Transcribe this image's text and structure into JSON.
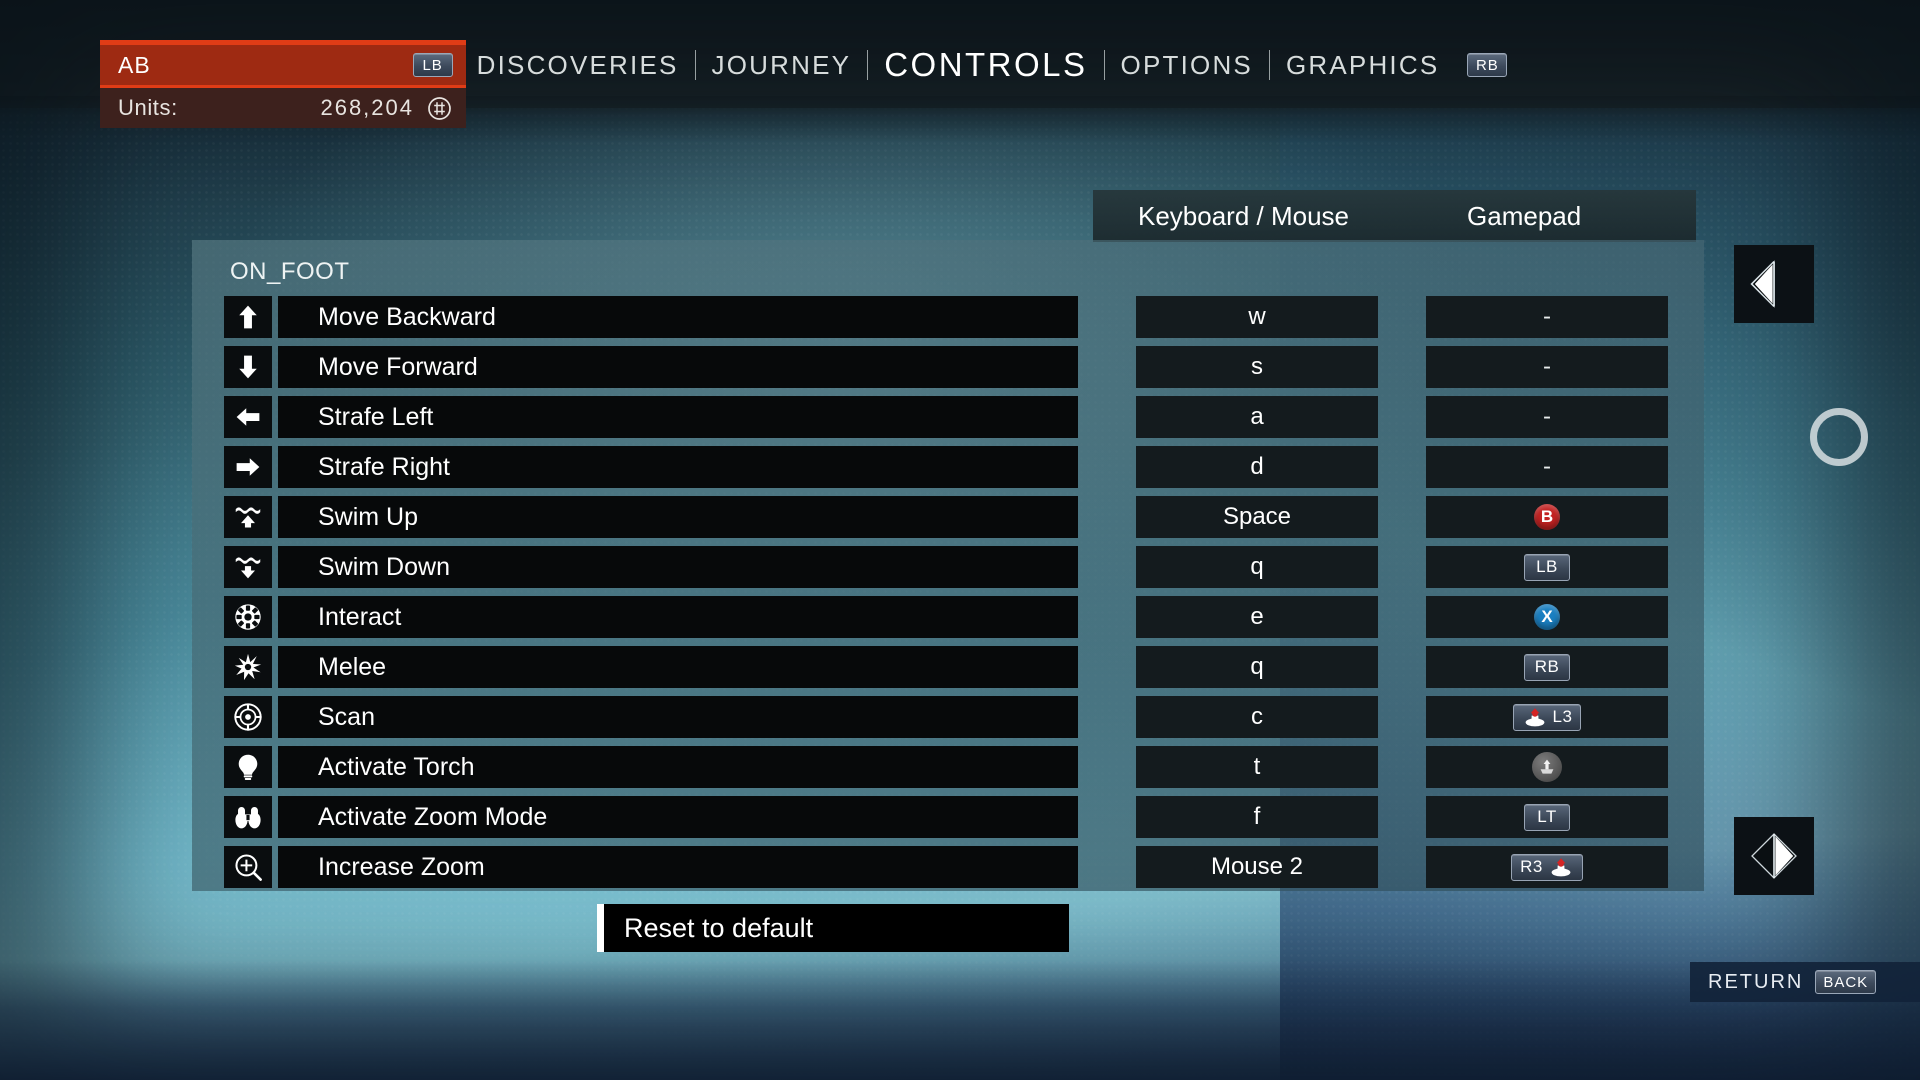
{
  "player": {
    "name": "AB",
    "units_label": "Units:",
    "units_value": "268,204",
    "currency_icon": "units-coin-icon"
  },
  "topnav": {
    "lb_chip": "LB",
    "rb_chip": "RB",
    "items": [
      {
        "label": "DISCOVERIES",
        "active": false
      },
      {
        "label": "JOURNEY",
        "active": false
      },
      {
        "label": "CONTROLS",
        "active": true
      },
      {
        "label": "OPTIONS",
        "active": false
      },
      {
        "label": "GRAPHICS",
        "active": false
      }
    ]
  },
  "tabs": {
    "keyboard_mouse": "Keyboard / Mouse",
    "gamepad": "Gamepad"
  },
  "panel": {
    "section_title": "ON_FOOT",
    "rows": [
      {
        "icon": "arrow-up-icon",
        "action": "Move Backward",
        "keyboard": "w",
        "gamepad_type": "text",
        "gamepad": "-"
      },
      {
        "icon": "arrow-down-icon",
        "action": "Move Forward",
        "keyboard": "s",
        "gamepad_type": "text",
        "gamepad": "-"
      },
      {
        "icon": "arrow-left-icon",
        "action": "Strafe Left",
        "keyboard": "a",
        "gamepad_type": "text",
        "gamepad": "-"
      },
      {
        "icon": "arrow-right-icon",
        "action": "Strafe Right",
        "keyboard": "d",
        "gamepad_type": "text",
        "gamepad": "-"
      },
      {
        "icon": "swim-up-icon",
        "action": "Swim Up",
        "keyboard": "Space",
        "gamepad_type": "round",
        "gamepad": "B"
      },
      {
        "icon": "swim-down-icon",
        "action": "Swim Down",
        "keyboard": "q",
        "gamepad_type": "chip",
        "gamepad": "LB"
      },
      {
        "icon": "gear-icon",
        "action": "Interact",
        "keyboard": "e",
        "gamepad_type": "round",
        "gamepad": "X"
      },
      {
        "icon": "melee-burst-icon",
        "action": "Melee",
        "keyboard": "q",
        "gamepad_type": "chip",
        "gamepad": "RB"
      },
      {
        "icon": "scan-target-icon",
        "action": "Scan",
        "keyboard": "c",
        "gamepad_type": "stick-left",
        "gamepad": "L3"
      },
      {
        "icon": "torch-bulb-icon",
        "action": "Activate Torch",
        "keyboard": "t",
        "gamepad_type": "dpad",
        "gamepad": ""
      },
      {
        "icon": "binoculars-icon",
        "action": "Activate Zoom Mode",
        "keyboard": "f",
        "gamepad_type": "chip",
        "gamepad": "LT"
      },
      {
        "icon": "zoom-in-icon",
        "action": "Increase Zoom",
        "keyboard": "Mouse 2",
        "gamepad_type": "stick-right",
        "gamepad": "R3"
      }
    ]
  },
  "reset": {
    "label": "Reset to default"
  },
  "nav_arrows": {
    "left": "prev-page-arrow",
    "right": "next-page-arrow"
  },
  "footer": {
    "return_label": "RETURN",
    "back_chip": "BACK"
  },
  "colors": {
    "accent_red": "#e03c16",
    "name_bg": "#9e2a12",
    "units_bg": "#3d211d",
    "row_bg": "#07090a",
    "bind_bg": "#141b1e",
    "panel_bg": "#4a707a"
  }
}
